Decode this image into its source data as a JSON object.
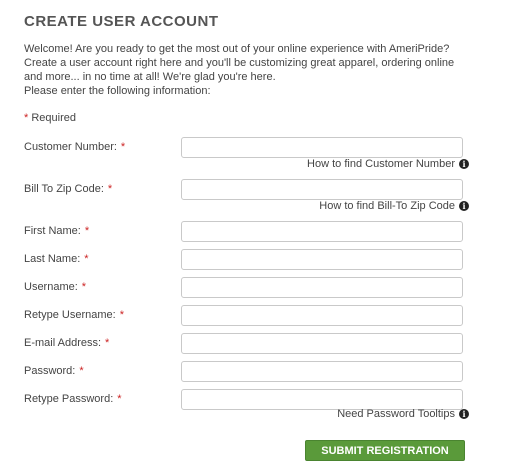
{
  "page": {
    "title": "CREATE USER ACCOUNT",
    "intro_lines": [
      "Welcome! Are you ready to get the most out of your online experience with AmeriPride?",
      "Create a user account right here and you'll be customizing great apparel, ordering online",
      "and more... in no time at all! We're glad you're here.",
      "Please enter the following information:"
    ],
    "required_note": "Required",
    "required_marker": "*"
  },
  "fields": [
    {
      "label": "Customer Number:",
      "value": ""
    },
    {
      "label": "Bill To Zip Code:",
      "value": ""
    },
    {
      "label": "First Name:",
      "value": ""
    },
    {
      "label": "Last Name:",
      "value": ""
    },
    {
      "label": "Username:",
      "value": ""
    },
    {
      "label": "Retype Username:",
      "value": ""
    },
    {
      "label": "E-mail Address:",
      "value": ""
    },
    {
      "label": "Password:",
      "value": ""
    },
    {
      "label": "Retype Password:",
      "value": ""
    }
  ],
  "help_links": {
    "customer_number": "How to find Customer Number",
    "zip_code": "How to find Bill-To Zip Code",
    "password": "Need Password Tooltips",
    "icon_glyph": "i"
  },
  "submit": {
    "label": "SUBMIT REGISTRATION",
    "color": "#5a9a3a"
  }
}
